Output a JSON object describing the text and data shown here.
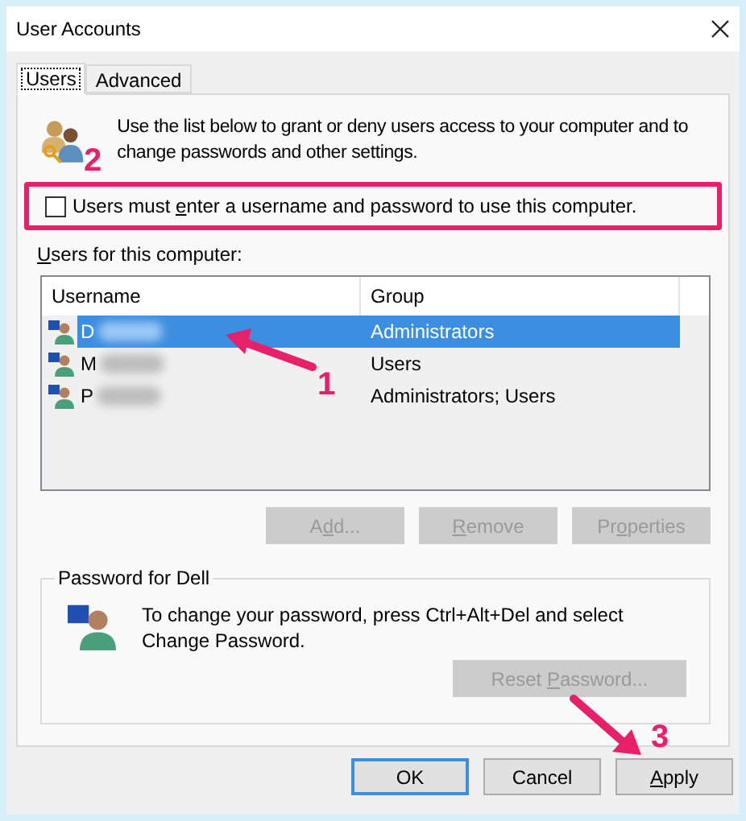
{
  "window": {
    "title": "User Accounts"
  },
  "tabs": [
    {
      "label": "Users",
      "selected": true
    },
    {
      "label": "Advanced",
      "selected": false
    }
  ],
  "description": "Use the list below to grant or deny users access to your computer and to change passwords and other settings.",
  "require_login": {
    "label": [
      {
        "text": "Users must "
      },
      {
        "text": "e",
        "underlined": true
      },
      {
        "text": "nter a username and password to use this computer."
      }
    ],
    "checked": false,
    "highlighted": true
  },
  "users_list": {
    "label": [
      {
        "text": "U",
        "underlined": true
      },
      {
        "text": "sers for this computer:"
      }
    ],
    "columns": [
      "Username",
      "Group"
    ],
    "rows": [
      {
        "username": "D",
        "group": "Administrators",
        "selected": true
      },
      {
        "username": "M",
        "group": "Users",
        "selected": false
      },
      {
        "username": "P",
        "group": "Administrators; Users",
        "selected": false
      }
    ]
  },
  "list_buttons": [
    {
      "label": [
        {
          "text": "A"
        },
        {
          "text": "d",
          "underlined": true
        },
        {
          "text": "d..."
        }
      ],
      "disabled": true
    },
    {
      "label": [
        {
          "text": "R",
          "underlined": true
        },
        {
          "text": "emove"
        }
      ],
      "disabled": true
    },
    {
      "label": [
        {
          "text": "Pr"
        },
        {
          "text": "o",
          "underlined": true
        },
        {
          "text": "perties"
        }
      ],
      "disabled": true
    }
  ],
  "password_group": {
    "title": "Password for Dell",
    "text": "To change your password, press Ctrl+Alt+Del and select Change Password.",
    "button": {
      "label": [
        {
          "text": "Reset "
        },
        {
          "text": "P",
          "underlined": true
        },
        {
          "text": "assword..."
        }
      ],
      "disabled": true
    }
  },
  "dialog_buttons": [
    {
      "label": [
        {
          "text": "OK"
        }
      ],
      "default": true
    },
    {
      "label": [
        {
          "text": "Cancel"
        }
      ],
      "default": false
    },
    {
      "label": [
        {
          "text": "A",
          "underlined": true
        },
        {
          "text": "pply"
        }
      ],
      "default": false
    }
  ],
  "annotations": [
    {
      "number": "2"
    },
    {
      "number": "1"
    },
    {
      "number": "3"
    }
  ]
}
